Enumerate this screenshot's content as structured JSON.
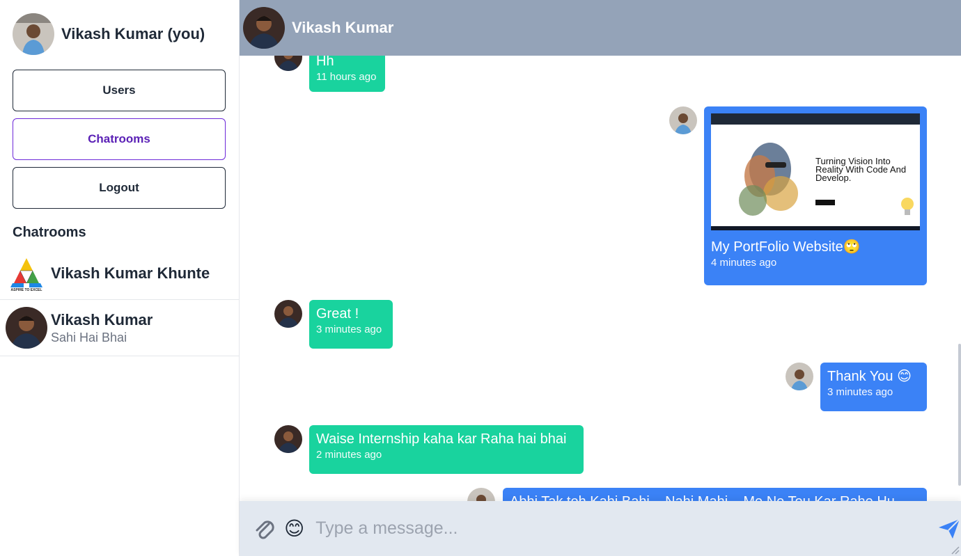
{
  "sidebar": {
    "current_user": "Vikash Kumar (you)",
    "nav": [
      "Users",
      "Chatrooms",
      "Logout"
    ],
    "section_title": "Chatrooms",
    "rooms": [
      {
        "name": "Vikash Kumar Khunte",
        "subtitle": ""
      },
      {
        "name": "Vikash Kumar",
        "subtitle": "Sahi Hai Bhai"
      }
    ],
    "logo_text": "ASPIRE TO EXCEL"
  },
  "header": {
    "title": "Vikash Kumar"
  },
  "messages": [
    {
      "direction": "in",
      "text": "Hh",
      "time": "11 hours ago"
    },
    {
      "direction": "out",
      "type": "image",
      "caption": "My PortFolio Website🙄",
      "time": "4 minutes ago",
      "image_texts": {
        "headline": "Turning Vision Into Reality With Code And Develop."
      }
    },
    {
      "direction": "in",
      "text": "Great !",
      "time": "3 minutes ago"
    },
    {
      "direction": "out",
      "text": "Thank You 😊",
      "time": "3 minutes ago"
    },
    {
      "direction": "in",
      "text": "Waise Internship kaha kar Raha hai bhai",
      "time": "2 minutes ago"
    },
    {
      "direction": "out",
      "text": "Abhi Tak toh Kahi Bahi... Nahi Mahi... Me Ne Tou Kar Rahe Hu",
      "time": ""
    }
  ],
  "composer": {
    "placeholder": "Type a message...",
    "emoji": "😊"
  },
  "colors": {
    "header_bg": "#94a3b8",
    "incoming_bubble": "#19d39e",
    "outgoing_bubble": "#3b82f6",
    "composer_bg": "#e2e8f0",
    "active_nav": "#5b21b6"
  }
}
